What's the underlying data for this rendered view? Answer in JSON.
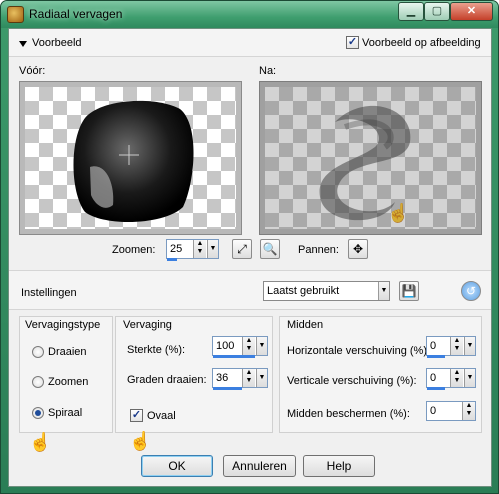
{
  "window": {
    "title": "Radiaal vervagen",
    "minimize": "▁",
    "maximize": "▢",
    "close": "✕"
  },
  "preview": {
    "section_label": "Voorbeeld",
    "preview_on_image_label": "Voorbeeld op afbeelding",
    "preview_on_image_checked": true,
    "before_label": "Vóór:",
    "after_label": "Na:",
    "zoom_label": "Zoomen:",
    "zoom_value": "25",
    "zoom_fraction": 0.25,
    "pan_label": "Pannen:"
  },
  "settings": {
    "label": "Instellingen",
    "preset_value": "Laatst gebruikt"
  },
  "blur_type": {
    "title": "Vervagingstype",
    "options": [
      "Draaien",
      "Zoomen",
      "Spiraal"
    ],
    "selected": "Spiraal"
  },
  "blur": {
    "title": "Vervaging",
    "strength_label": "Sterkte (%):",
    "strength_value": "100",
    "strength_fraction": 1.0,
    "twist_label": "Graden draaien:",
    "twist_value": "36",
    "twist_fraction": 0.7,
    "oval_label": "Ovaal",
    "oval_checked": true
  },
  "center": {
    "title": "Midden",
    "horizontal_label": "Horizontale verschuiving (%):",
    "horizontal_value": "0",
    "horizontal_fraction": 0.5,
    "vertical_label": "Verticale verschuiving (%):",
    "vertical_value": "0",
    "vertical_fraction": 0.5,
    "protect_label": "Midden beschermen (%):",
    "protect_value": "0"
  },
  "buttons": {
    "ok": "OK",
    "cancel": "Annuleren",
    "help": "Help"
  },
  "colors": {
    "accent": "#3b7fe0",
    "titlebar": "#3f9e6f"
  }
}
